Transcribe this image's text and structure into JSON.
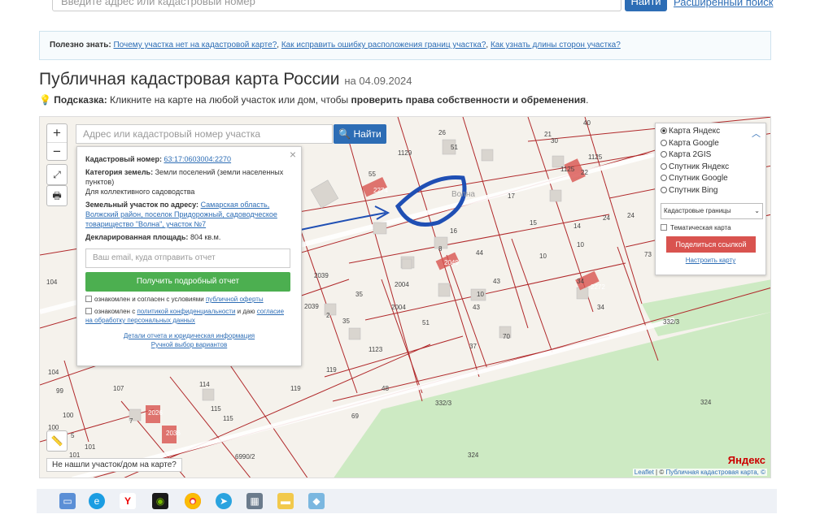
{
  "top": {
    "search_placeholder": "Введите адрес или кадастровый номер",
    "find_label": "Найти",
    "advanced_label": "Расширенный поиск"
  },
  "note": {
    "prefix": "Полезно знать:",
    "link1": "Почему участка нет на кадастровой карте?",
    "sep1": ",",
    "link2": "Как исправить ошибку расположения границ участка?",
    "sep2": ",",
    "link3": "Как узнать длины сторон участка?"
  },
  "page": {
    "title": "Публичная кадастровая карта России",
    "date": "на 04.09.2024"
  },
  "hint": {
    "label": "Подсказка:",
    "text": "Кликните на карте на любой участок или дом, чтобы",
    "bold": "проверить права собственности и обременения",
    "end": "."
  },
  "map": {
    "search_placeholder": "Адрес или кадастровый номер участка",
    "find_label": "Найти",
    "zoom_in": "+",
    "zoom_out": "−",
    "not_found": "Не нашли участок/дом на карте?",
    "yandex": "Яндекс",
    "attrib_leaflet": "Leaflet",
    "attrib_sep": " | © ",
    "attrib_pkk": "Публичная кадастровая карта, ©",
    "parcel_labels": [
      "26",
      "51",
      "1129",
      "21",
      "30",
      "40",
      "1125",
      "55",
      "2274",
      "Волна",
      "17",
      "1125",
      "22",
      "16",
      "15",
      "14",
      "24",
      "24",
      "8",
      "2049",
      "44",
      "10",
      "10",
      "73",
      "2039",
      "2004",
      "43",
      "34",
      "2272",
      "35",
      "2039",
      "2004",
      "10",
      "43",
      "34",
      "2",
      "35",
      "51",
      "70",
      "332/3",
      "1123",
      "37",
      "104",
      "104",
      "119",
      "119",
      "107",
      "114",
      "48",
      "99",
      "115",
      "115",
      "7",
      "2026",
      "332/3",
      "324",
      "100",
      "100",
      "5",
      "2036",
      "69",
      "101",
      "101",
      "6990/2",
      "324"
    ]
  },
  "popup": {
    "cad_label": "Кадастровый номер:",
    "cad_value": "63:17:0603004:2270",
    "cat_label": "Категория земель:",
    "cat_value": "Земли поселений (земли населенных пунктов)",
    "use_value": "Для коллективного садоводства",
    "addr_label": "Земельный участок по адресу:",
    "addr_value": "Самарская область, Волжский район, поселок Придорожный, садоводческое товарищество \"Волна\", участок №7",
    "area_label": "Декларированная площадь:",
    "area_value": "804 кв.м.",
    "email_placeholder": "Ваш email, куда отправить отчет",
    "report_label": "Получить подробный отчет",
    "agree1_text": "ознакомлен и согласен с условиями",
    "agree1_link": "публичной оферты",
    "agree2_text": "ознакомлен с",
    "agree2_link": "политикой конфиденциальности",
    "agree2_mid": "и даю",
    "agree2_link2": "согласие на обработку персональных данных",
    "details_link": "Детали отчета и юридическая информация",
    "manual_link": "Ручной выбор вариантов",
    "close": "×"
  },
  "layers": {
    "options": [
      "Карта Яндекс",
      "Карта Google",
      "Карта 2GIS",
      "Спутник Яндекс",
      "Спутник Google",
      "Спутник Bing"
    ],
    "selected": 0,
    "boundaries": "Кадастровые границы",
    "thematic": "Тематическая карта",
    "share": "Поделиться ссылкой",
    "setup": "Настроить карту"
  },
  "colors": {
    "accent": "#2d6db5",
    "green": "#4caf50",
    "red": "#d9534f",
    "parcel_line": "#b0282a",
    "forest": "#cdeac3"
  },
  "taskbar_icons": [
    "file-explorer-icon",
    "edge-icon",
    "yandex-browser-icon",
    "nvidia-icon",
    "chrome-icon",
    "telegram-icon",
    "calculator-icon",
    "folder-icon",
    "app-icon"
  ]
}
